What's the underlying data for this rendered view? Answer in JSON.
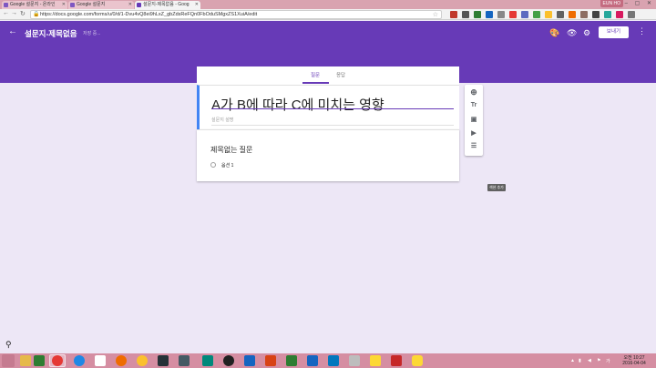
{
  "browser": {
    "tabs": [
      {
        "label": "Google 설문지 - 온라인",
        "color": "#673ab7"
      },
      {
        "label": "Google 설문지",
        "color": "#673ab7"
      },
      {
        "label": "설문지-제목없음 - Goog",
        "color": "#673ab7"
      }
    ],
    "user_badge": "EUN HO",
    "window_controls": "– ▢ ✕",
    "url": "https://docs.google.com/forms/u/0/d/1-Dvu4vQ8ei9hLxZ_gbZdsReFQn0FbOduSMgxZS1XuiA/edit"
  },
  "header": {
    "title": "설문지-제목없음",
    "save_status": "저장 중...",
    "send_label": "보내기",
    "accent": "#673ab7"
  },
  "form": {
    "tabs": [
      "질문",
      "응답"
    ],
    "title": "A가 B에 따라 C에 미치는 영향",
    "description_placeholder": "설문지 설명",
    "question_title": "제목없는 질문",
    "option_label": "옵션 1"
  },
  "tools": {
    "icons": [
      "add-question-icon",
      "add-title-icon",
      "add-image-icon",
      "add-video-icon",
      "add-section-icon"
    ],
    "tooltip": "섹션 추가"
  },
  "taskbar": {
    "time": "오전 10:27",
    "date": "2016-04-04"
  }
}
